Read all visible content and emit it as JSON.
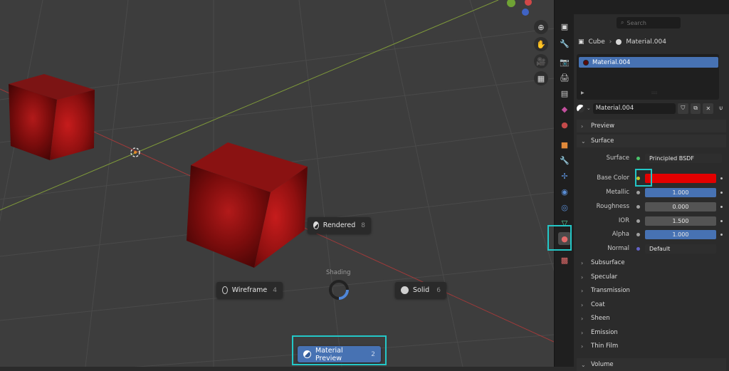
{
  "viewport": {
    "shading_label": "Shading",
    "pie_items": [
      {
        "label": "Rendered",
        "key": "8"
      },
      {
        "label": "Wireframe",
        "key": "4"
      },
      {
        "label": "Solid",
        "key": "6"
      },
      {
        "label": "Material Preview",
        "key": "2"
      }
    ]
  },
  "properties": {
    "search_placeholder": "Search",
    "breadcrumb": {
      "object": "Cube",
      "material": "Material.004"
    },
    "slot_name": "Material.004",
    "material_name": "Material.004",
    "panels": {
      "preview": "Preview",
      "surface": "Surface"
    },
    "surface": {
      "surface_label": "Surface",
      "surface_value": "Principled BSDF",
      "base_color_label": "Base Color",
      "base_color_hex": "#e30000",
      "metallic_label": "Metallic",
      "metallic_value": "1.000",
      "roughness_label": "Roughness",
      "roughness_value": "0.000",
      "ior_label": "IOR",
      "ior_value": "1.500",
      "alpha_label": "Alpha",
      "alpha_value": "1.000",
      "normal_label": "Normal",
      "normal_value": "Default"
    },
    "subpanels": [
      "Subsurface",
      "Specular",
      "Transmission",
      "Coat",
      "Sheen",
      "Emission",
      "Thin Film"
    ],
    "volume": "Volume"
  },
  "colors": {
    "accent": "#4772b3",
    "highlight": "#23c7c7"
  },
  "icons": {
    "viewport_tools": [
      "zoom-icon",
      "hand-icon",
      "camera-icon",
      "grid-icon"
    ],
    "tabs": [
      "tool-icon",
      "render-icon",
      "output-icon",
      "view-layer-icon",
      "scene-icon",
      "world-icon",
      "object-icon",
      "modifier-icon",
      "particles-icon",
      "physics-icon",
      "constraints-icon",
      "data-icon",
      "material-icon",
      "texture-icon"
    ]
  }
}
